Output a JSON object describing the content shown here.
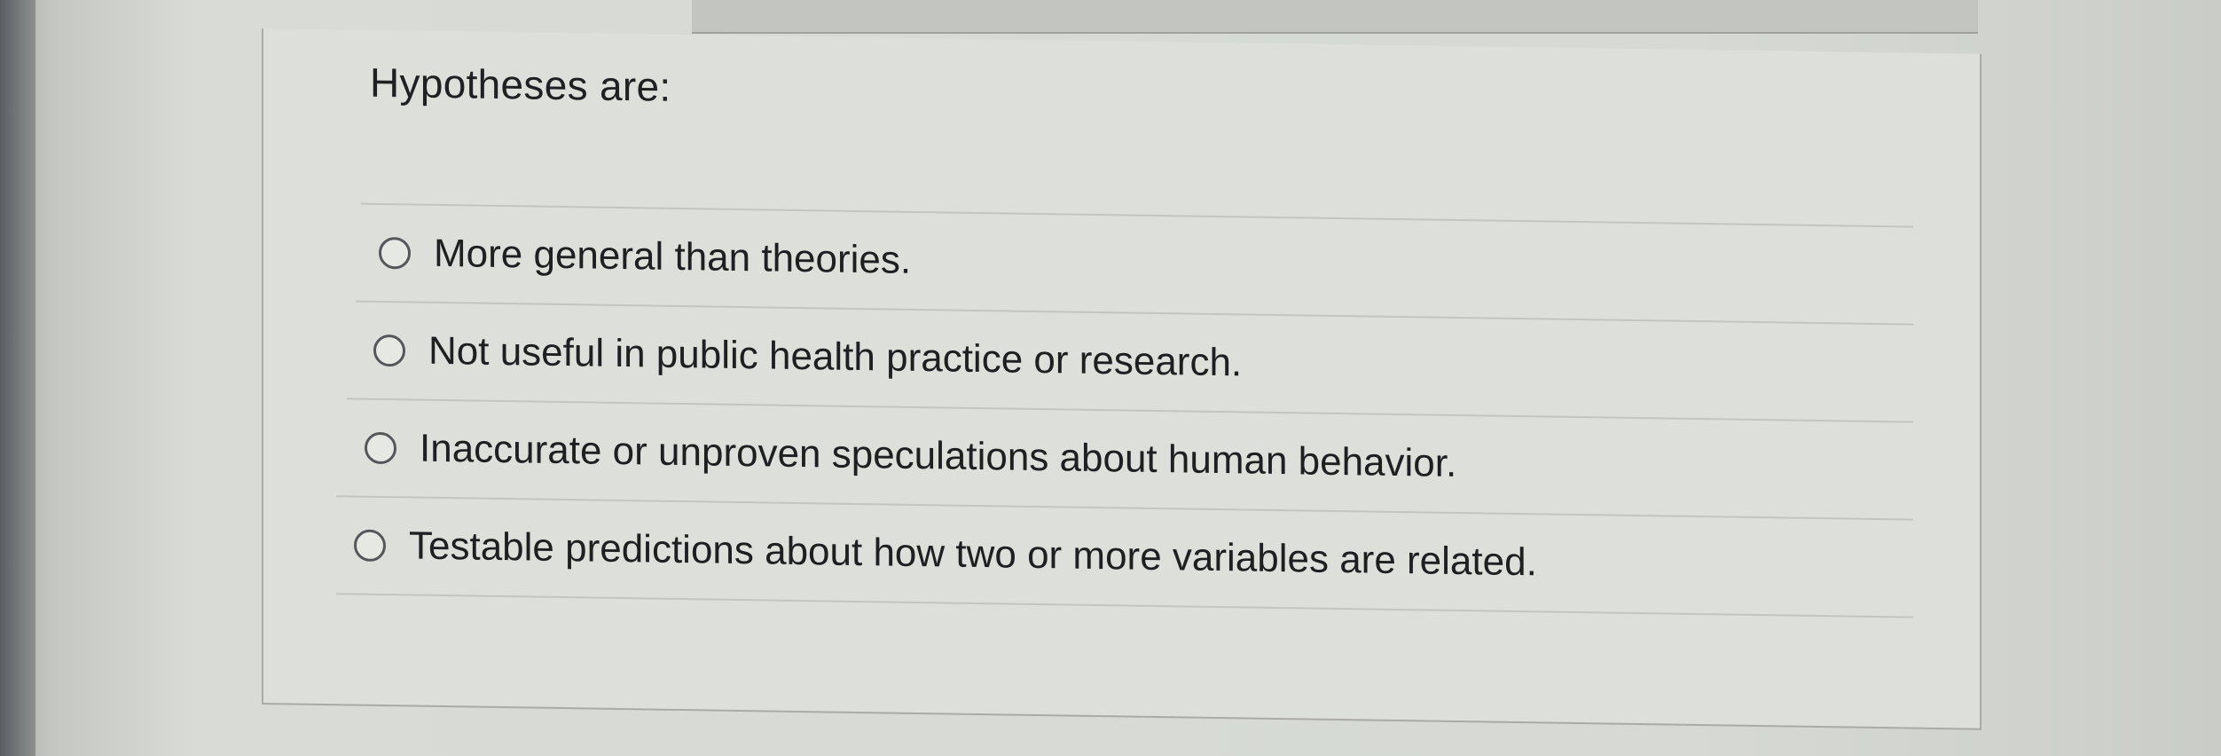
{
  "question": {
    "text": "Hypotheses are:"
  },
  "options": [
    {
      "label": "More general than theories.",
      "selected": false
    },
    {
      "label": "Not useful in public health practice or research.",
      "selected": false
    },
    {
      "label": "Inaccurate or unproven speculations about human behavior.",
      "selected": false
    },
    {
      "label": "Testable predictions about how two or more variables are related.",
      "selected": false
    }
  ]
}
